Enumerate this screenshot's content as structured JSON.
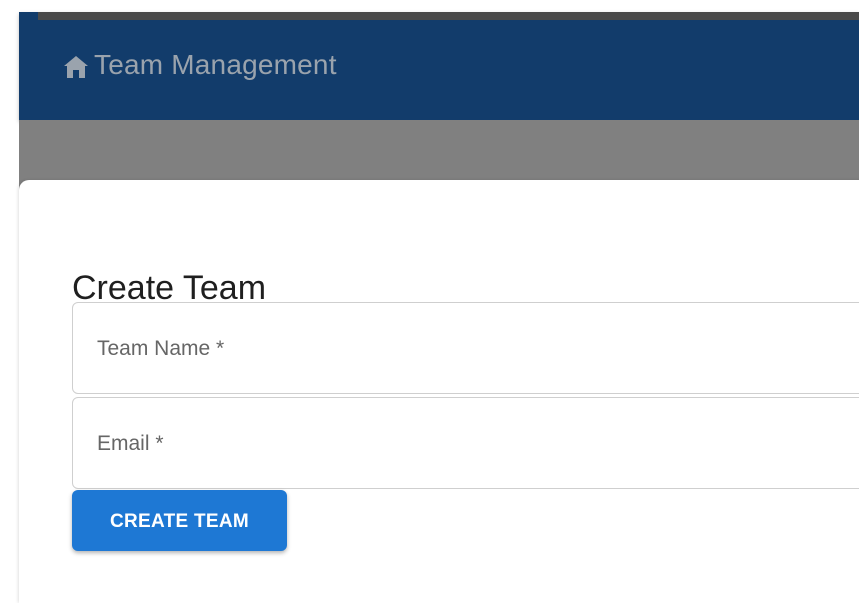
{
  "header": {
    "title": "Team Management",
    "icon": "home-icon",
    "background_color": "#123c6b"
  },
  "dialog": {
    "title": "Create Team",
    "fields": [
      {
        "label": "Team Name *",
        "value": ""
      },
      {
        "label": "Email *",
        "value": ""
      }
    ],
    "submit_button": {
      "label": "CREATE TEAM",
      "color": "#1e78d4"
    }
  }
}
